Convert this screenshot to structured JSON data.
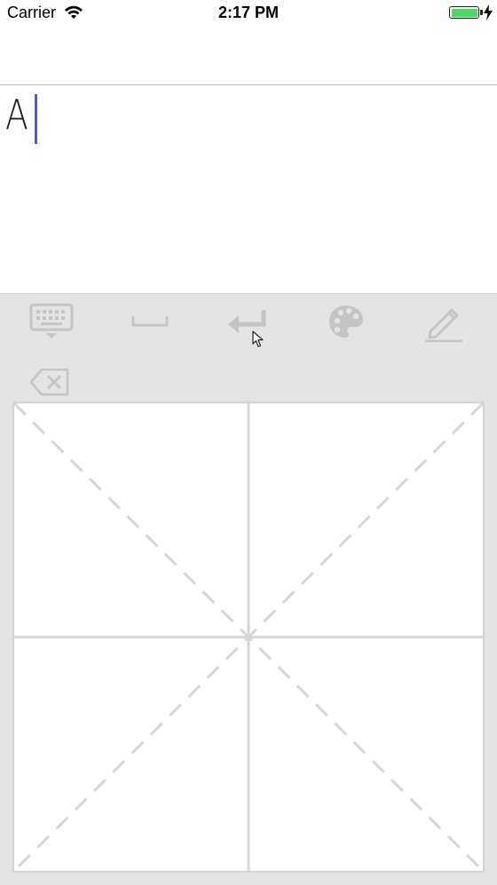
{
  "status_bar": {
    "carrier": "Carrier",
    "time": "2:17 PM",
    "wifi_icon": "wifi-icon",
    "battery_icon": "battery-icon",
    "battery_color": "#4cd964",
    "charging_icon": "lightning-bolt-icon"
  },
  "editor": {
    "text": "A",
    "cursor_color": "#4a5bd8"
  },
  "toolbar": {
    "buttons": [
      {
        "name": "keyboard-toggle",
        "icon": "keyboard-icon"
      },
      {
        "name": "space",
        "icon": "space-bar-icon"
      },
      {
        "name": "return",
        "icon": "return-arrow-icon"
      },
      {
        "name": "color",
        "icon": "palette-icon"
      },
      {
        "name": "pen",
        "icon": "pencil-icon"
      }
    ],
    "icon_color": "#c4c4c4"
  },
  "backspace": {
    "icon": "backspace-icon"
  },
  "drawing_pad": {
    "guide": "cross with dashed diagonals",
    "guide_color": "#d6d6d6"
  }
}
